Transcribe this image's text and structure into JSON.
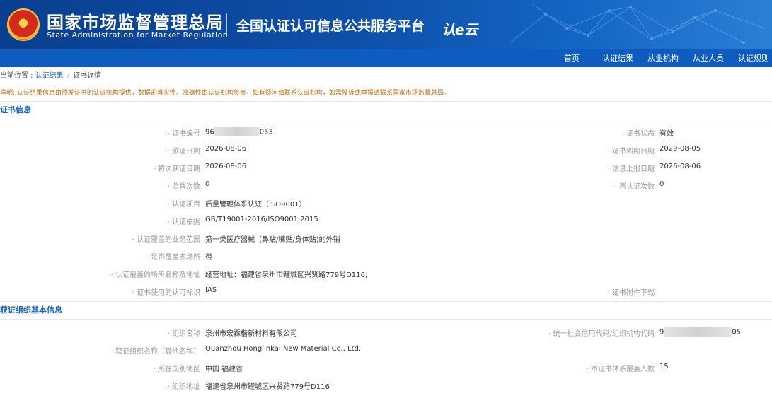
{
  "header": {
    "agency_cn": "国家市场监督管理总局",
    "agency_en": "State Administration  for  Market Regulation",
    "platform": "全国认证认可信息公共服务平台",
    "logo_text": "认e云"
  },
  "nav": {
    "items": [
      "首页",
      "认证结果",
      "从业机构",
      "从业人员",
      "认证规则"
    ]
  },
  "breadcrumb": {
    "prefix": "当前位置 : ",
    "link": "认证结果",
    "separator": "/",
    "current": "证书详情"
  },
  "notice": "声明: 认证结果信息由颁发证书的认证机构提供，数据的真实性、准确性由认证机构负责，如有疑问请联系认证机构，如需投诉或举报请联系国家市场监督总局。",
  "cert_section": {
    "title": "证书信息",
    "cert_no_label": "· 证书编号",
    "cert_no_prefix": "96",
    "cert_no_suffix": "053",
    "status_label": "· 证书状态",
    "status_value": "有效",
    "issue_date_label": "· 颁证日期",
    "issue_date_value": "2026-08-06",
    "expiry_label": "· 证书到期日期",
    "expiry_value": "2029-08-05",
    "first_date_label": "· 初次获证日期",
    "first_date_value": "2026-08-06",
    "report_date_label": "· 信息上报日期",
    "report_date_value": "2026-08-06",
    "supervision_label": "· 监督次数",
    "supervision_value": "0",
    "recert_label": "· 再认证次数",
    "recert_value": "0",
    "project_label": "· 认证项目",
    "project_value": "质量管理体系认证（ISO9001）",
    "basis_label": "· 认证依据",
    "basis_value": "GB/T19001-2016/ISO9001:2015",
    "scope_label": "· 认证覆盖的业务范围",
    "scope_value": "第一类医疗器械（鼻贴/嘴贴/身体贴)的外销",
    "multisite_label": "· 是否覆盖多场所",
    "multisite_value": "否",
    "address_label": "· 认证覆盖的场所名称及地址",
    "address_value": "经营地址：福建省泉州市鲤城区兴贤路779号D116;",
    "mark_label": "· 证书使用的认可标识",
    "mark_value": "IAS",
    "attachment_label": "· 证书附件下载"
  },
  "org_section": {
    "title": "获证组织基本信息",
    "org_name_label": "· 组织名称",
    "org_name_value": "泉州市宏霖楷新材料有限公司",
    "credit_label": "· 统一社会信用代码/组织机构代码",
    "credit_prefix": "9",
    "credit_suffix": "05",
    "other_name_label": "· 获证组织名称（其他名称）",
    "other_name_value": "Quanzhou Honglinkai New Material Co., Ltd.",
    "region_label": "· 所在国别地区",
    "region_value": "中国 福建省",
    "headcount_label": "· 本证书体系覆盖人数",
    "headcount_value": "15",
    "org_address_label": "· 组织地址",
    "org_address_value": "福建省泉州市鲤城区兴贤路779号D116"
  }
}
